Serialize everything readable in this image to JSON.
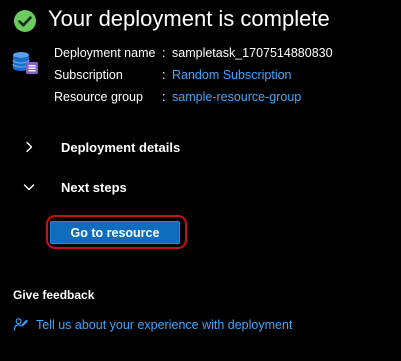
{
  "header": {
    "title": "Your deployment is complete",
    "status_icon": "checkmark-circle-icon",
    "status_color": "#6ccb5f"
  },
  "deployment_info": {
    "icon": "deployment-resource-icon",
    "name_label": "Deployment name",
    "name_value": "sampletask_1707514880830",
    "subscription_label": "Subscription",
    "subscription_value": "Random Subscription",
    "resource_group_label": "Resource group",
    "resource_group_value": "sample-resource-group",
    "separator": ":"
  },
  "sections": {
    "details_label": "Deployment details",
    "details_expanded": false,
    "next_steps_label": "Next steps",
    "next_steps_expanded": true
  },
  "actions": {
    "go_to_resource_label": "Go to resource"
  },
  "feedback": {
    "heading": "Give feedback",
    "link_text": "Tell us about your experience with deployment",
    "icon": "feedback-person-icon"
  },
  "colors": {
    "background": "#000000",
    "link": "#3ea6ff",
    "primary_button": "#0f6cbd",
    "highlight": "#c50f1f"
  }
}
